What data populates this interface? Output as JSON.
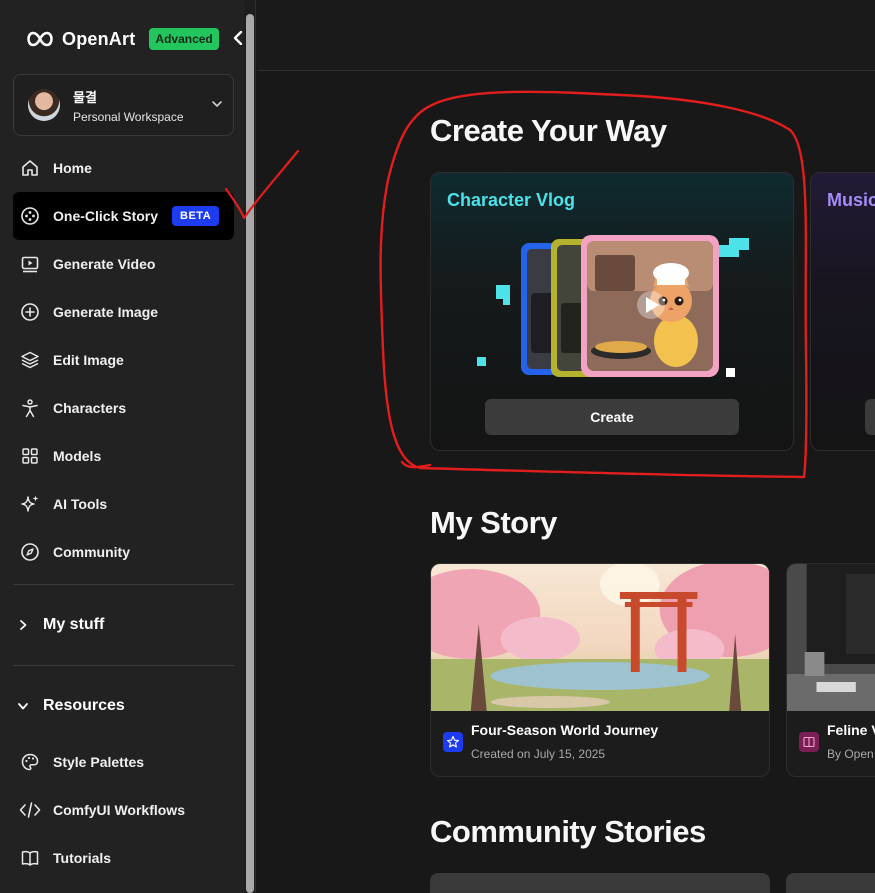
{
  "brand": {
    "name": "OpenArt",
    "plan_badge": "Advanced",
    "badge_color": "#22c55e"
  },
  "workspace": {
    "user_name": "물결",
    "workspace_label": "Personal Workspace"
  },
  "nav": [
    {
      "label": "Home",
      "icon": "home-icon"
    },
    {
      "label": "One-Click Story",
      "icon": "film-reel-icon",
      "badge": "BETA",
      "active": true
    },
    {
      "label": "Generate Video",
      "icon": "video-icon"
    },
    {
      "label": "Generate Image",
      "icon": "plus-circle-icon"
    },
    {
      "label": "Edit Image",
      "icon": "layers-icon"
    },
    {
      "label": "Characters",
      "icon": "person-icon"
    },
    {
      "label": "Models",
      "icon": "grid-icon"
    },
    {
      "label": "AI Tools",
      "icon": "sparkle-icon"
    },
    {
      "label": "Community",
      "icon": "compass-icon"
    }
  ],
  "sections": {
    "my_stuff": "My stuff",
    "resources": "Resources"
  },
  "resources": [
    {
      "label": "Style Palettes",
      "icon": "palette-icon"
    },
    {
      "label": "ComfyUI Workflows",
      "icon": "code-icon"
    },
    {
      "label": "Tutorials",
      "icon": "book-icon"
    }
  ],
  "main": {
    "create_heading": "Create Your Way",
    "create_cards": [
      {
        "title": "Character Vlog",
        "button": "Create",
        "accent": "#4de1e8"
      },
      {
        "title": "Music",
        "accent": "#a38cf7"
      }
    ],
    "story_heading": "My Story",
    "stories": [
      {
        "title": "Four-Season World Journey",
        "meta": "Created on July 15, 2025"
      },
      {
        "title": "Feline V",
        "meta": "By Open"
      }
    ],
    "community_heading": "Community Stories"
  },
  "annotation_color": "#e11d1d"
}
